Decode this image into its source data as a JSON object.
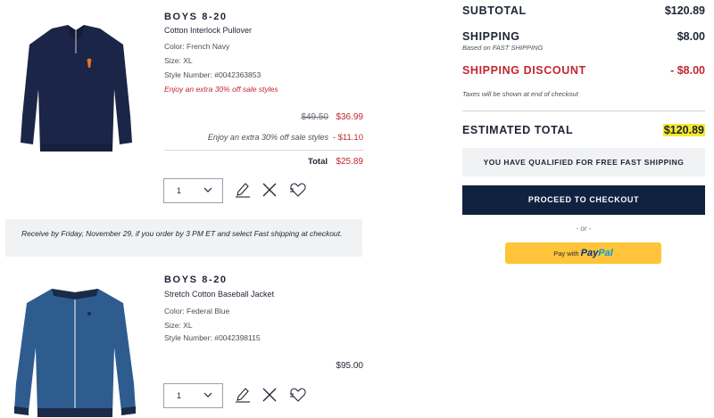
{
  "cart": {
    "items": [
      {
        "brand": "BOYS 8-20",
        "name": "Cotton Interlock Pullover",
        "color": "Color: French Navy",
        "size": "Size: XL",
        "style_number": "Style Number: #0042363853",
        "promo_note": "Enjoy an extra 30% off sale styles",
        "price_original": "$49.50",
        "price_sale": "$36.99",
        "discount_label": "Enjoy an extra 30% off sale styles",
        "discount_value": "- $11.10",
        "total_label": "Total",
        "total_value": "$25.89",
        "quantity": "1",
        "image_icon": "navy-quarter-zip-pullover-image"
      },
      {
        "brand": "BOYS 8-20",
        "name": "Stretch Cotton Baseball Jacket",
        "color": "Color: Federal Blue",
        "size": "Size: XL",
        "style_number": "Style Number: #0042398115",
        "price": "$95.00",
        "quantity": "1",
        "image_icon": "blue-baseball-jacket-image"
      }
    ],
    "shipping_note": "Receive by Friday, November 29, if you order by 3 PM ET and select Fast shipping at checkout.",
    "action_icons": [
      "edit-pencil-icon",
      "remove-x-icon",
      "wishlist-heart-icon"
    ]
  },
  "summary": {
    "subtotal_label": "SUBTOTAL",
    "subtotal_value": "$120.89",
    "shipping_label": "SHIPPING",
    "shipping_value": "$8.00",
    "shipping_basis": "Based on FAST SHIPPING",
    "shipping_discount_label": "SHIPPING DISCOUNT",
    "shipping_discount_value": "- $8.00",
    "taxes_note": "Taxes will be shown at end of checkout",
    "estimated_total_label": "ESTIMATED TOTAL",
    "estimated_total_value": "$120.89",
    "free_shipping_message": "YOU HAVE QUALIFIED FOR FREE FAST SHIPPING",
    "checkout_label": "PROCEED TO CHECKOUT",
    "or_label": "- or -",
    "paypal_prefix": "Pay with",
    "paypal_brand_pay": "Pay",
    "paypal_brand_pal": "Pal"
  },
  "colors": {
    "navy": "#0f2240",
    "sale_red": "#c2272d",
    "highlight_yellow": "#f7ea2c",
    "paypal_yellow": "#ffc439",
    "panel_gray": "#f1f2f4"
  }
}
